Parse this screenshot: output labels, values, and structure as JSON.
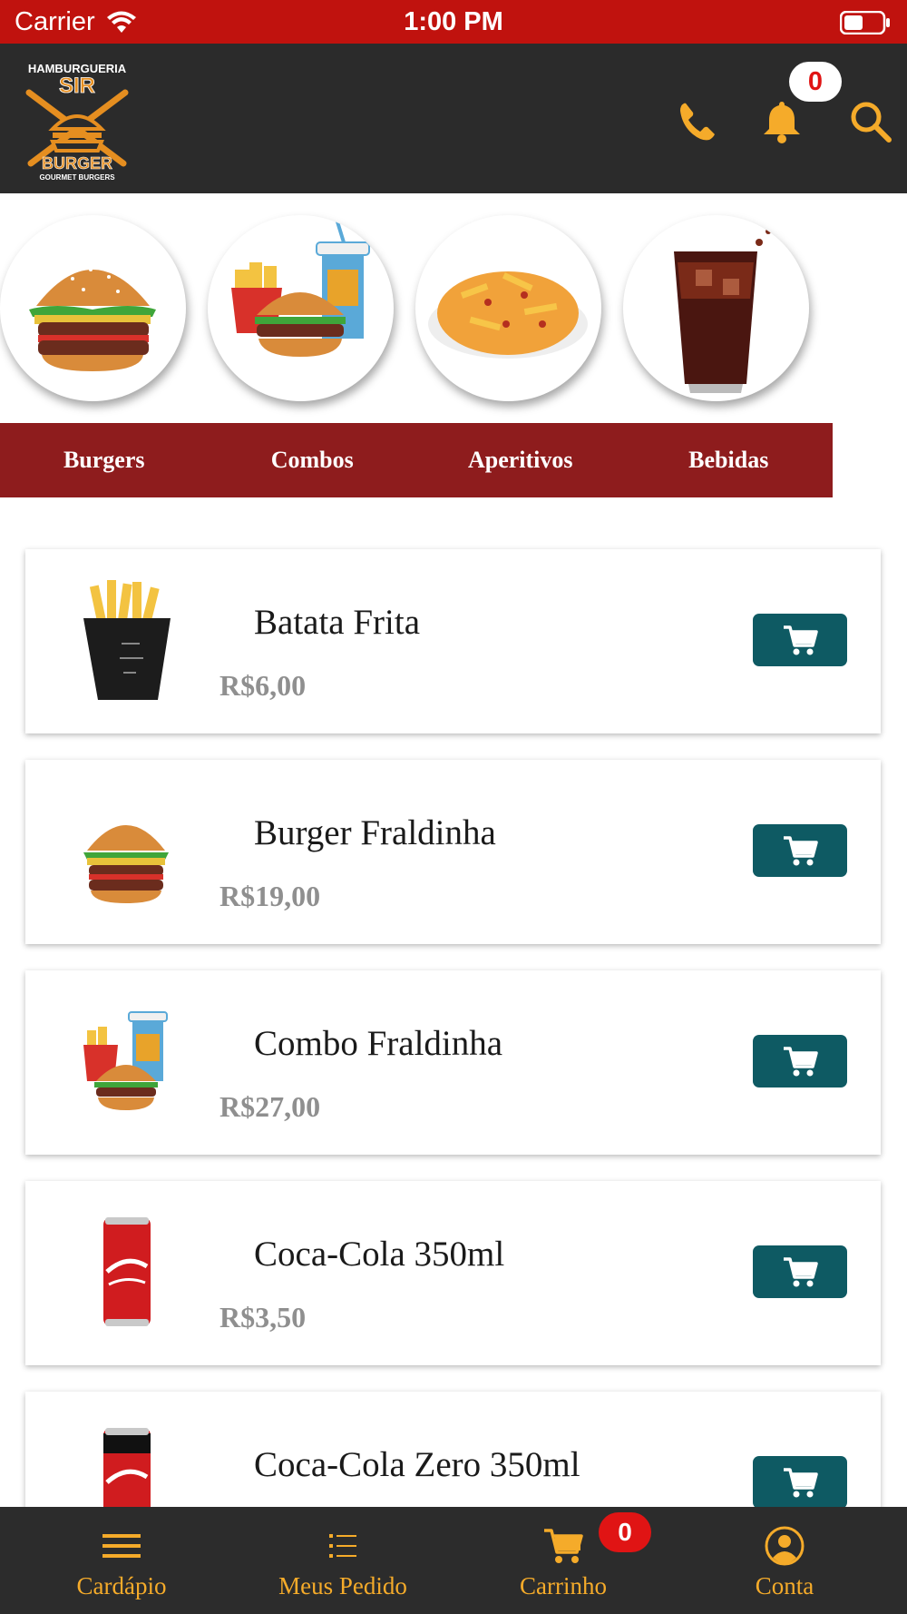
{
  "status_bar": {
    "carrier": "Carrier",
    "time": "1:00 PM"
  },
  "header": {
    "logo": {
      "line1": "HAMBURGUERIA",
      "line2": "SIR",
      "line3": "BURGER",
      "line4": "GOURMET BURGERS"
    },
    "notification_count": "0",
    "icons": [
      "phone-icon",
      "bell-icon",
      "search-icon"
    ]
  },
  "categories": [
    {
      "label": "Burgers",
      "image": "burger"
    },
    {
      "label": "Combos",
      "image": "combo"
    },
    {
      "label": "Aperitivos",
      "image": "fries-plate"
    },
    {
      "label": "Bebidas",
      "image": "soda-glass"
    }
  ],
  "products": [
    {
      "name": "Batata Frita",
      "price": "R$6,00",
      "image": "fries-box"
    },
    {
      "name": "Burger Fraldinha",
      "price": "R$19,00",
      "image": "burger"
    },
    {
      "name": "Combo Fraldinha",
      "price": "R$27,00",
      "image": "combo"
    },
    {
      "name": "Coca-Cola 350ml",
      "price": "R$3,50",
      "image": "coke-can"
    },
    {
      "name": "Coca-Cola Zero 350ml",
      "price": "",
      "image": "coke-zero-can"
    }
  ],
  "bottom_nav": {
    "items": [
      {
        "label": "Cardápio",
        "icon": "menu-icon"
      },
      {
        "label": "Meus Pedido",
        "icon": "list-icon"
      },
      {
        "label": "Carrinho",
        "icon": "cart-icon"
      },
      {
        "label": "Conta",
        "icon": "account-icon"
      }
    ],
    "cart_count": "0"
  },
  "colors": {
    "status_bar": "#c0120e",
    "header_bg": "#2b2b2b",
    "accent": "#f5ab2a",
    "category_bar": "#8e1c1d",
    "cart_button": "#0e5a63",
    "badge": "#e01414"
  }
}
